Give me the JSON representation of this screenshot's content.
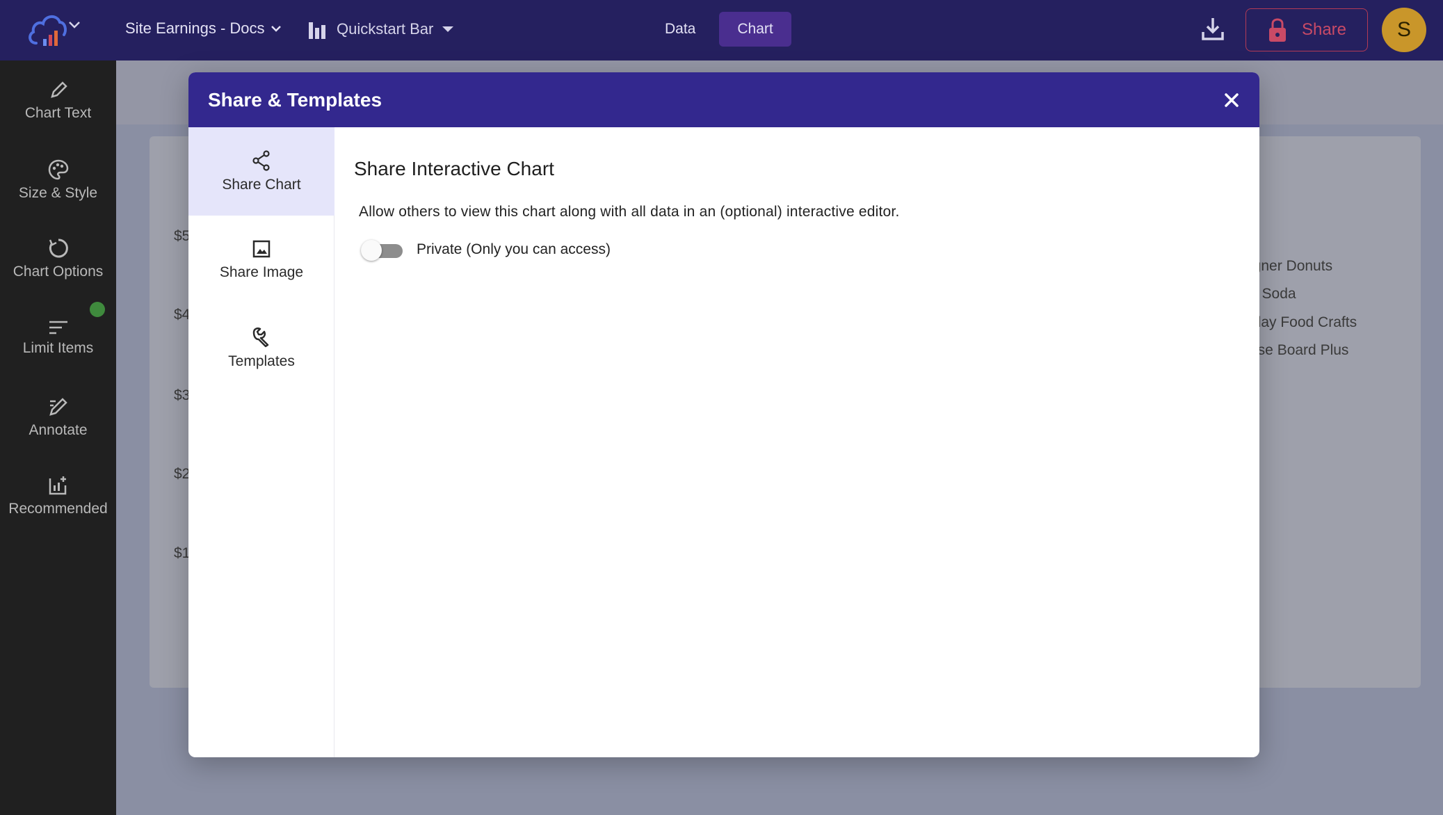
{
  "topbar": {
    "doc_title": "Site Earnings - Docs",
    "chart_type": "Quickstart Bar",
    "tabs": [
      {
        "label": "Data",
        "active": false
      },
      {
        "label": "Chart",
        "active": true
      }
    ],
    "share_label": "Share",
    "avatar_initial": "S"
  },
  "sidebar": {
    "items": [
      {
        "label": "Chart Text",
        "icon": "pencil-icon"
      },
      {
        "label": "Size & Style",
        "icon": "palette-icon"
      },
      {
        "label": "Chart Options",
        "icon": "circle-arrow-icon"
      },
      {
        "label": "Limit Items",
        "icon": "filter-lines-icon",
        "indicator": true
      },
      {
        "label": "Annotate",
        "icon": "annotate-icon"
      },
      {
        "label": "Recommended",
        "icon": "chart-plus-icon"
      }
    ]
  },
  "background": {
    "y_labels": [
      "$5",
      "$4",
      "$3",
      "$2",
      "$1"
    ],
    "legend": [
      "igner Donuts",
      "e Soda",
      "iday Food Crafts",
      "ese Board Plus"
    ]
  },
  "modal": {
    "title": "Share & Templates",
    "side_items": [
      {
        "label": "Share Chart",
        "icon": "share-icon",
        "active": true
      },
      {
        "label": "Share Image",
        "icon": "image-icon",
        "active": false
      },
      {
        "label": "Templates",
        "icon": "wrench-icon",
        "active": false
      }
    ],
    "main": {
      "title": "Share Interactive Chart",
      "description": "Allow others to view this chart along with all data in an (optional) interactive editor.",
      "toggle_label": "Private (Only you can access)",
      "toggle_on": false
    }
  },
  "colors": {
    "topbar": "#25205f",
    "modal_header": "#33288e",
    "share_accent": "#c94a66",
    "avatar": "#c9962a"
  }
}
